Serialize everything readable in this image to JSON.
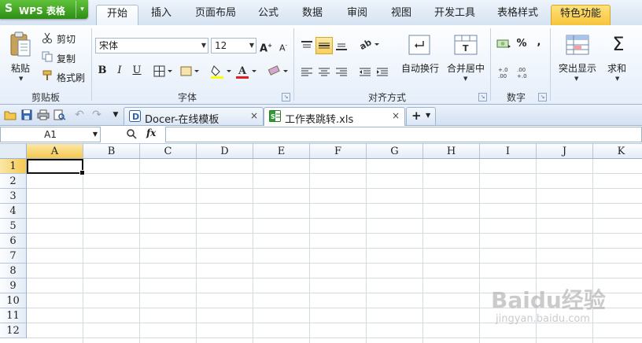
{
  "app": {
    "logo": "S",
    "title": "WPS 表格",
    "menu_arrow": "▾"
  },
  "tabs": [
    {
      "label": "开始"
    },
    {
      "label": "插入"
    },
    {
      "label": "页面布局"
    },
    {
      "label": "公式"
    },
    {
      "label": "数据"
    },
    {
      "label": "审阅"
    },
    {
      "label": "视图"
    },
    {
      "label": "开发工具"
    },
    {
      "label": "表格样式"
    },
    {
      "label": "特色功能"
    }
  ],
  "ribbon": {
    "clipboard": {
      "group": "剪贴板",
      "paste": "粘贴",
      "cut": "剪切",
      "copy": "复制",
      "format_painter": "格式刷"
    },
    "font": {
      "group": "字体",
      "font_name": "宋体",
      "font_size": "12",
      "bold": "B",
      "italic": "I",
      "underline": "U",
      "grow": "A",
      "shrink": "A"
    },
    "alignment": {
      "group": "对齐方式",
      "wrap": "自动换行",
      "merge": "合并居中"
    },
    "number": {
      "group": "数字",
      "percent": "%",
      "comma": ","
    },
    "highlight": "突出显示",
    "sum": "求和",
    "accent": "#f5c94f"
  },
  "doc_tabs": [
    {
      "label": "Docer-在线模板",
      "close": "×"
    },
    {
      "label": "工作表跳转.xls",
      "close": "×"
    }
  ],
  "new_tab": "+",
  "formula_bar": {
    "name_box": "A1",
    "fx": "fx"
  },
  "columns": [
    "A",
    "B",
    "C",
    "D",
    "E",
    "F",
    "G",
    "H",
    "I",
    "J",
    "K"
  ],
  "rows": [
    "1",
    "2",
    "3",
    "4",
    "5",
    "6",
    "7",
    "8",
    "9",
    "10",
    "11",
    "12"
  ],
  "watermark": {
    "brand": "Baidu经验",
    "url": "jingyan.baidu.com"
  }
}
